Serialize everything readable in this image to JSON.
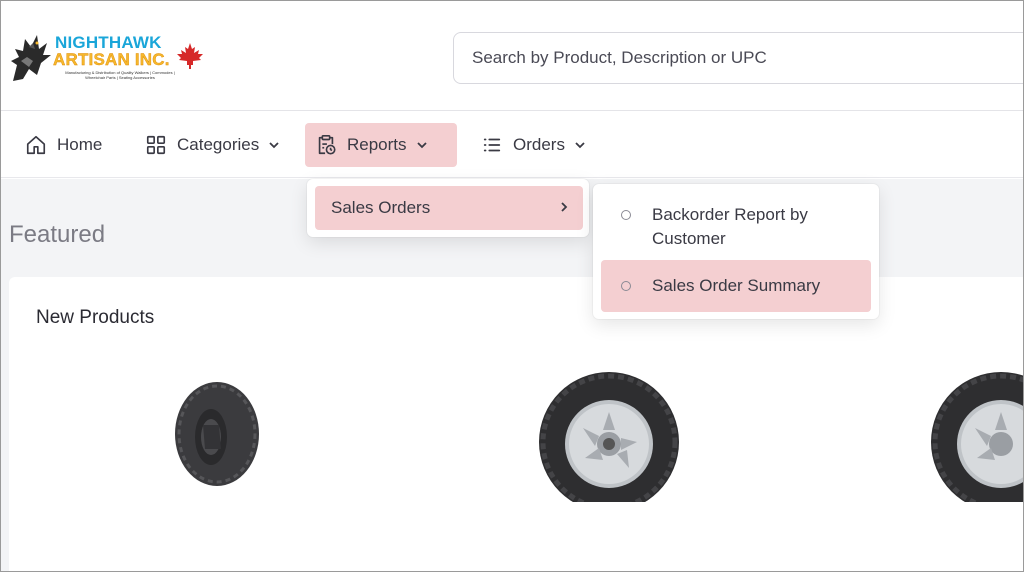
{
  "header": {
    "logo": {
      "line1": "NIGHTHAWK",
      "line2": "ARTISAN INC.",
      "tagline": "Manufacturing & Distribution of Quality Walkers | Commodes | Wheelchair Parts | Seating Accessories"
    },
    "search": {
      "placeholder": "Search by Product, Description or UPC"
    }
  },
  "nav": {
    "items": [
      {
        "label": "Home",
        "icon": "home-icon"
      },
      {
        "label": "Categories",
        "icon": "grid-icon"
      },
      {
        "label": "Reports",
        "icon": "clipboard-clock-icon",
        "active": true
      },
      {
        "label": "Orders",
        "icon": "list-icon"
      }
    ]
  },
  "menus": {
    "reports": {
      "items": [
        {
          "label": "Sales Orders",
          "has_submenu": true
        }
      ]
    },
    "sales_orders": {
      "items": [
        {
          "label_line1": "Backorder Report by",
          "label_line2": "Customer"
        },
        {
          "label": "Sales Order Summary",
          "highlighted": true
        }
      ]
    }
  },
  "main": {
    "section_title": "Featured",
    "card_title": "New Products"
  },
  "colors": {
    "active_highlight": "#f4cfd1",
    "logo_blue": "#1aa6d9",
    "logo_yellow": "#f5b82e",
    "maple_red": "#d62828"
  }
}
